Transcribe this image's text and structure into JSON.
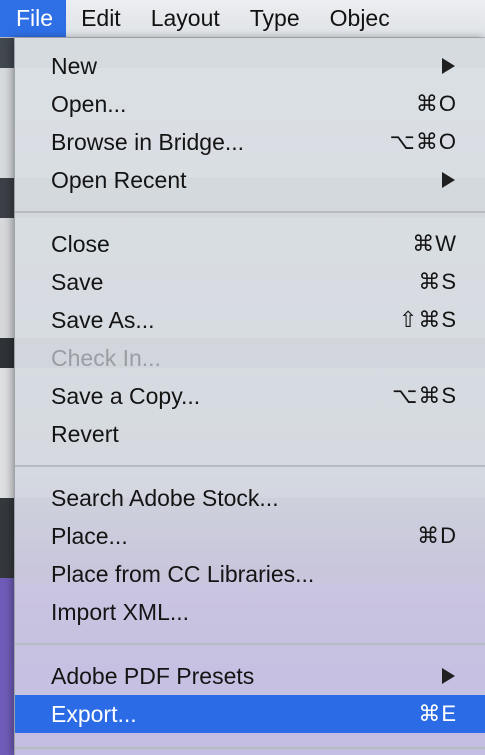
{
  "menubar": {
    "items": [
      {
        "label": "File",
        "active": true
      },
      {
        "label": "Edit"
      },
      {
        "label": "Layout"
      },
      {
        "label": "Type"
      },
      {
        "label": "Objec"
      }
    ]
  },
  "file_menu": {
    "groups": [
      [
        {
          "label": "New",
          "submenu": true
        },
        {
          "label": "Open...",
          "shortcut": "⌘O"
        },
        {
          "label": "Browse in Bridge...",
          "shortcut": "⌥⌘O"
        },
        {
          "label": "Open Recent",
          "submenu": true
        }
      ],
      [
        {
          "label": "Close",
          "shortcut": "⌘W"
        },
        {
          "label": "Save",
          "shortcut": "⌘S"
        },
        {
          "label": "Save As...",
          "shortcut": "⇧⌘S"
        },
        {
          "label": "Check In...",
          "disabled": true
        },
        {
          "label": "Save a Copy...",
          "shortcut": "⌥⌘S"
        },
        {
          "label": "Revert"
        }
      ],
      [
        {
          "label": "Search Adobe Stock..."
        },
        {
          "label": "Place...",
          "shortcut": "⌘D"
        },
        {
          "label": "Place from CC Libraries..."
        },
        {
          "label": "Import XML..."
        }
      ],
      [
        {
          "label": "Adobe PDF Presets",
          "submenu": true
        },
        {
          "label": "Export...",
          "shortcut": "⌘E",
          "highlighted": true
        }
      ]
    ]
  },
  "colors": {
    "highlight": "#2c6be6",
    "disabled_text": "#9a9da3"
  }
}
